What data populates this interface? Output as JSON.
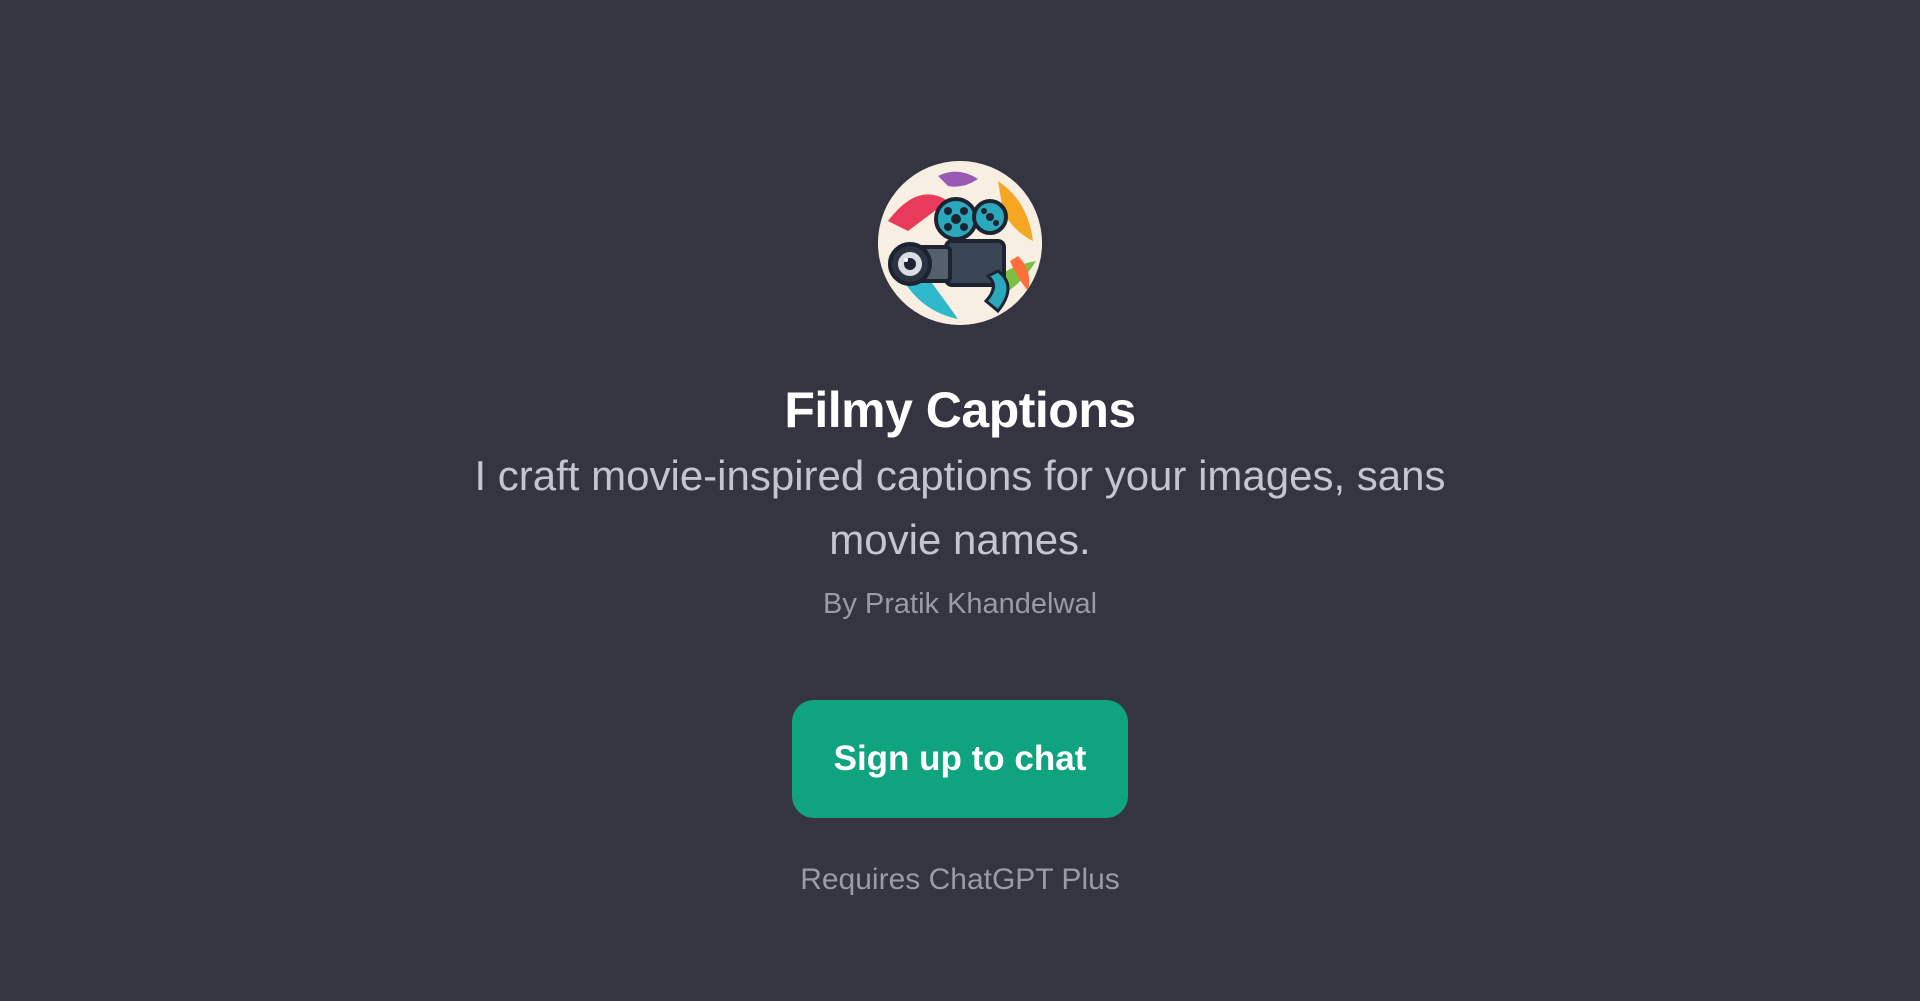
{
  "gpt": {
    "title": "Filmy Captions",
    "description": "I craft movie-inspired captions for your images, sans movie names.",
    "author": "By Pratik Khandelwal",
    "avatar_icon": "film-camera-icon"
  },
  "actions": {
    "signup_label": "Sign up to chat",
    "requirement": "Requires ChatGPT Plus"
  },
  "colors": {
    "background": "#343541",
    "accent": "#10a37f",
    "title": "#ffffff",
    "description": "#c5c5d2",
    "muted": "#9a9aa8"
  }
}
